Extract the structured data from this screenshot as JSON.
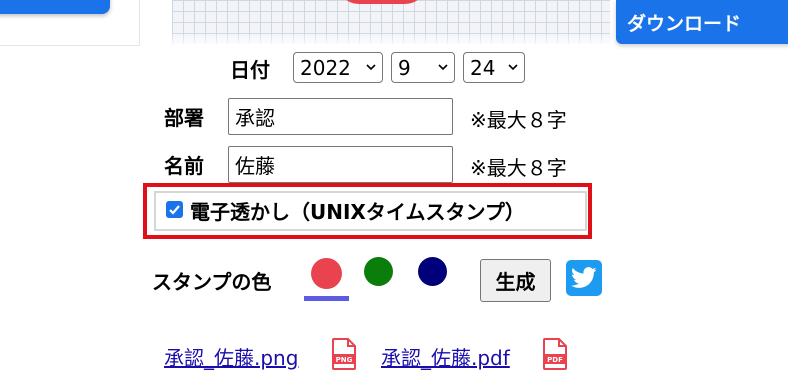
{
  "header": {
    "download_label": "ダウンロード"
  },
  "date": {
    "label": "日付",
    "year": "2022",
    "month": "9",
    "day": "24"
  },
  "department": {
    "label": "部署",
    "value": "承認",
    "note": "※最大８字"
  },
  "name": {
    "label": "名前",
    "value": "佐藤",
    "note": "※最大８字"
  },
  "watermark": {
    "label": "電子透かし（UNIXタイムスタンプ）",
    "checked": true
  },
  "stamp_color": {
    "label": "スタンプの色",
    "colors": [
      "#e8434f",
      "#0b7d0b",
      "#00007a"
    ],
    "selected_index": 0
  },
  "generate_label": "生成",
  "downloads": {
    "png_link": "承認_佐藤.png",
    "pdf_link": "承認_佐藤.pdf",
    "png_badge": "PNG",
    "pdf_badge": "PDF"
  },
  "icons": [
    "chevron-down-icon",
    "checkbox-check-icon",
    "twitter-icon",
    "png-file-icon",
    "pdf-file-icon"
  ]
}
